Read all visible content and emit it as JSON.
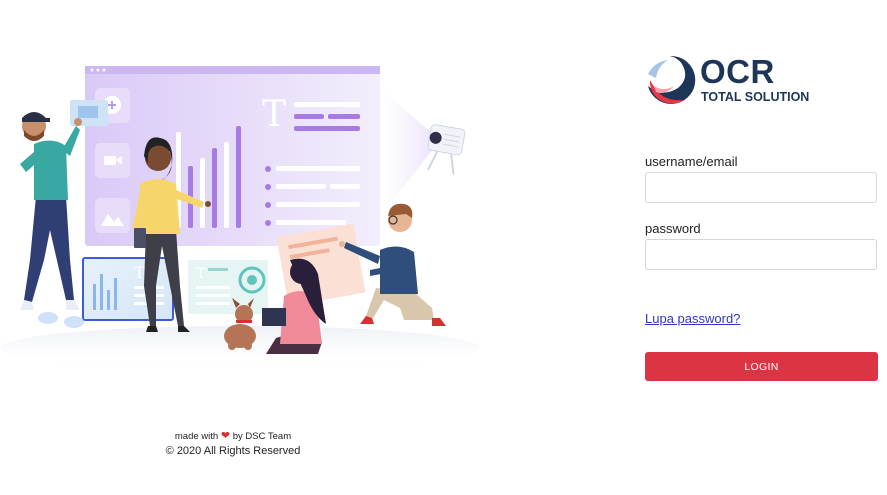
{
  "brand": {
    "name": "OCR",
    "tagline": "TOTAL SOLUTION"
  },
  "form": {
    "username_label": "username/email",
    "username_value": "",
    "password_label": "password",
    "password_value": "",
    "forgot_link": "Lupa password?",
    "login_button": "LOGIN"
  },
  "footer": {
    "made_prefix": "made with",
    "made_suffix": "by DSC Team",
    "copyright": "© 2020 All Rights Reserved"
  },
  "icons": {
    "heart": "heart-icon",
    "logo": "ocr-logo-icon"
  },
  "colors": {
    "accent": "#db3545",
    "link": "#2f36c8",
    "brand_navy": "#1d3557"
  }
}
